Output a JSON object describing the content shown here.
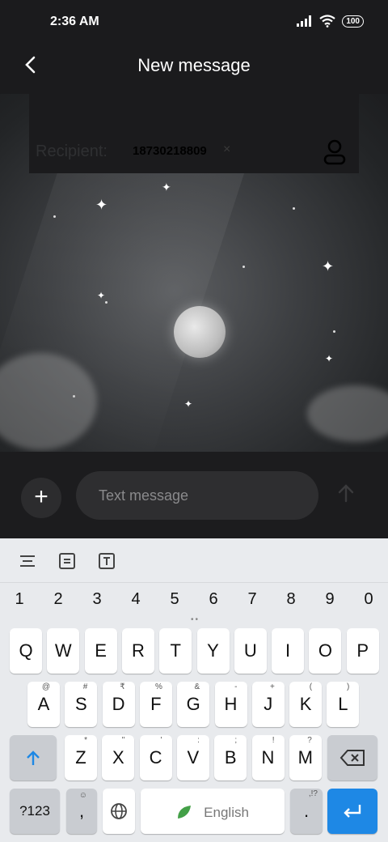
{
  "status_bar": {
    "time": "2:36 AM",
    "battery": "100"
  },
  "header": {
    "title": "New message",
    "back_icon": "back-arrow-icon"
  },
  "recipient": {
    "label": "Recipient:",
    "value": "18730218809",
    "remove": "×",
    "contact_icon": "person-icon"
  },
  "compose": {
    "add": "+",
    "placeholder": "Text message",
    "send_icon": "send-arrow-icon"
  },
  "keyboard": {
    "toolbar": [
      "menu-icon",
      "clipboard-icon",
      "text-icon"
    ],
    "numbers": [
      "1",
      "2",
      "3",
      "4",
      "5",
      "6",
      "7",
      "8",
      "9",
      "0"
    ],
    "row1": [
      "Q",
      "W",
      "E",
      "R",
      "T",
      "Y",
      "U",
      "I",
      "O",
      "P"
    ],
    "row2": [
      "A",
      "S",
      "D",
      "F",
      "G",
      "H",
      "J",
      "K",
      "L"
    ],
    "row2_sub": [
      "@",
      "#",
      "₹",
      "%",
      "&",
      "-",
      "+",
      "(",
      ")"
    ],
    "row3": [
      "Z",
      "X",
      "C",
      "V",
      "B",
      "N",
      "M"
    ],
    "row3_sub": [
      "*",
      "\"",
      "'",
      ":",
      ";",
      "!",
      "?"
    ],
    "symbols_key": "?123",
    "comma_key": ",",
    "space_label": "English",
    "period_key": ".",
    "period_sub": ",!?",
    "colors": {
      "enter": "#1e88e5",
      "shift_arrow": "#1e88e5"
    }
  }
}
